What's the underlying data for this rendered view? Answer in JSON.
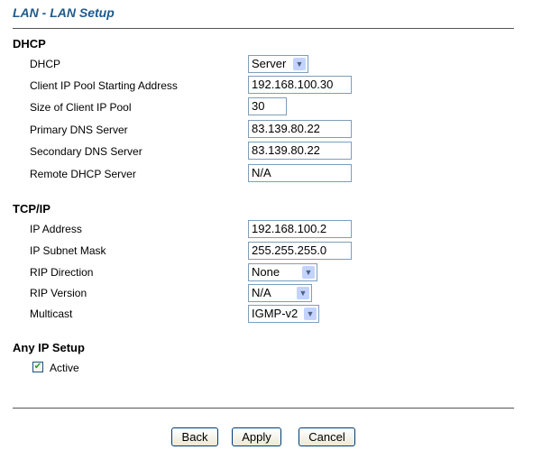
{
  "title": "LAN - LAN Setup",
  "dhcp": {
    "heading": "DHCP",
    "dhcp_label": "DHCP",
    "dhcp_value": "Server",
    "pool_start_label": "Client IP Pool Starting Address",
    "pool_start_value": "192.168.100.30",
    "pool_size_label": "Size of Client IP Pool",
    "pool_size_value": "30",
    "primary_dns_label": "Primary DNS Server",
    "primary_dns_value": "83.139.80.22",
    "secondary_dns_label": "Secondary DNS Server",
    "secondary_dns_value": "83.139.80.22",
    "remote_dhcp_label": "Remote DHCP Server",
    "remote_dhcp_value": "N/A"
  },
  "tcpip": {
    "heading": "TCP/IP",
    "ip_label": "IP Address",
    "ip_value": "192.168.100.2",
    "mask_label": "IP Subnet Mask",
    "mask_value": "255.255.255.0",
    "rip_dir_label": "RIP Direction",
    "rip_dir_value": "None",
    "rip_ver_label": "RIP Version",
    "rip_ver_value": "N/A",
    "multicast_label": "Multicast",
    "multicast_value": "IGMP-v2"
  },
  "anyip": {
    "heading": "Any IP Setup",
    "active_label": "Active",
    "active_checked": true
  },
  "buttons": {
    "back": "Back",
    "apply": "Apply",
    "cancel": "Cancel"
  }
}
